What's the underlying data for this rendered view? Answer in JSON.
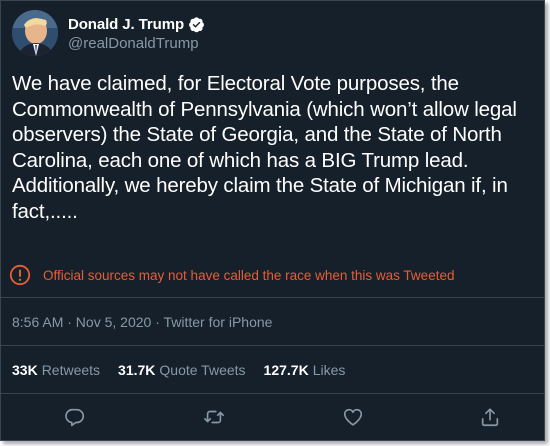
{
  "tweet": {
    "display_name": "Donald J. Trump",
    "handle": "@realDonaldTrump",
    "text": "We have claimed, for Electoral Vote purposes, the Commonwealth of Pennsylvania (which won’t allow legal observers) the State of Georgia, and the State of North Carolina, each one of which has a BIG Trump lead. Additionally, we hereby claim the State of Michigan if, in fact,.....",
    "notice": "Official sources may not have called the race when this was Tweeted",
    "timestamp": "8:56 AM · Nov 5, 2020 · Twitter for iPhone"
  },
  "stats": [
    {
      "count": "33K",
      "label": "Retweets"
    },
    {
      "count": "31.7K",
      "label": "Quote Tweets"
    },
    {
      "count": "127.7K",
      "label": "Likes"
    }
  ],
  "icons": {
    "verified": "verified-badge-icon",
    "notice": "alert-circle-icon",
    "reply": "reply-icon",
    "retweet": "retweet-icon",
    "like": "heart-icon",
    "share": "share-icon"
  },
  "colors": {
    "background": "#15202b",
    "text": "#ffffff",
    "secondary": "#8899a6",
    "notice": "#e85d34",
    "verified": "#1da1f2",
    "divider": "#38444d"
  }
}
